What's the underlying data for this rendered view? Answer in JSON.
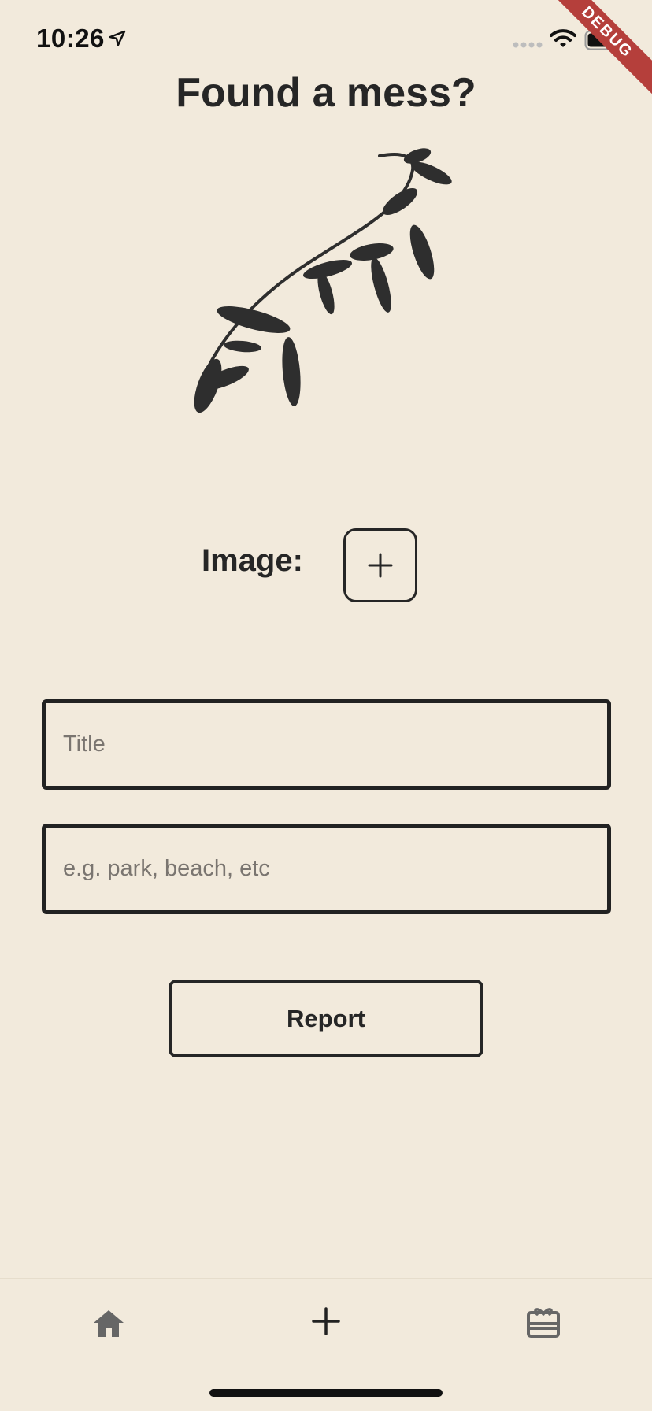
{
  "status_bar": {
    "time": "10:26",
    "icons": [
      "location-arrow-icon",
      "signal-icon",
      "wifi-icon",
      "battery-icon"
    ]
  },
  "debug_banner": "DEBUG",
  "page": {
    "title": "Found a mess?",
    "illustration": "leafy-branch-illustration"
  },
  "image_picker": {
    "label": "Image:",
    "button_icon": "plus-icon"
  },
  "form": {
    "title_placeholder": "Title",
    "title_value": "",
    "location_placeholder": "e.g. park, beach, etc",
    "location_value": "",
    "submit_label": "Report"
  },
  "bottom_nav": {
    "items": [
      {
        "icon": "home-icon",
        "active": false
      },
      {
        "icon": "plus-icon",
        "active": true
      },
      {
        "icon": "gift-card-icon",
        "active": false
      }
    ]
  },
  "colors": {
    "background": "#f2eadc",
    "ink": "#262626",
    "debug_ribbon": "#b53f3b",
    "nav_inactive": "#666666"
  }
}
